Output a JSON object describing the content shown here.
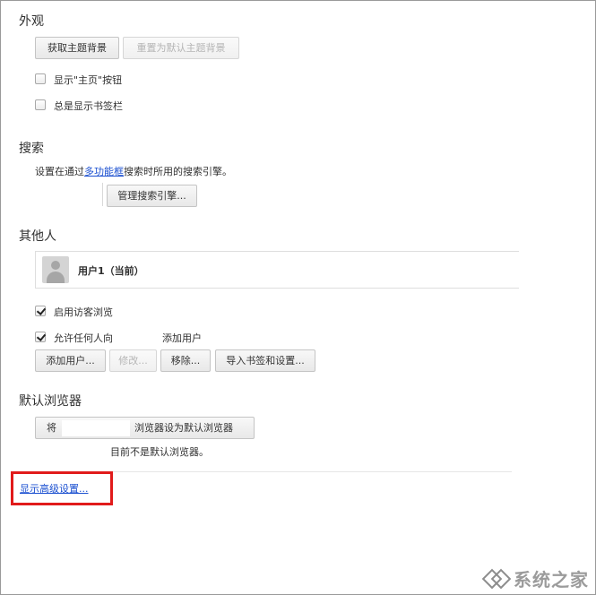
{
  "appearance": {
    "title": "外观",
    "get_themes_button": "获取主题背景",
    "reset_theme_button": "重置为默认主题背景",
    "show_home_button_label": "显示\"主页\"按钮",
    "show_home_button_checked": false,
    "show_bookmarks_bar_label": "总是显示书签栏",
    "show_bookmarks_bar_checked": false
  },
  "search": {
    "title": "搜索",
    "desc_prefix": "设置在通过",
    "desc_link": "多功能框",
    "desc_suffix": "搜索时所用的搜索引擎。",
    "manage_button": "管理搜索引擎..."
  },
  "people": {
    "title": "其他人",
    "current_profile": "用户1（当前）",
    "guest_browsing_label": "启用访客浏览",
    "guest_browsing_checked": true,
    "allow_anyone_label": "允许任何人向",
    "allow_anyone_checked": true,
    "add_user_text": "添加用户",
    "add_user_button": "添加用户...",
    "edit_button": "修改...",
    "remove_button": "移除...",
    "import_button": "导入书签和设置..."
  },
  "default_browser": {
    "title": "默认浏览器",
    "make_default_prefix": "将",
    "make_default_suffix": "浏览器设为默认浏览器",
    "status_text": "目前不是默认浏览器。"
  },
  "advanced_link": "显示高级设置...",
  "watermark": "系统之家",
  "colors": {
    "link": "#1a4fd0",
    "highlight_box": "#e11b1b"
  }
}
